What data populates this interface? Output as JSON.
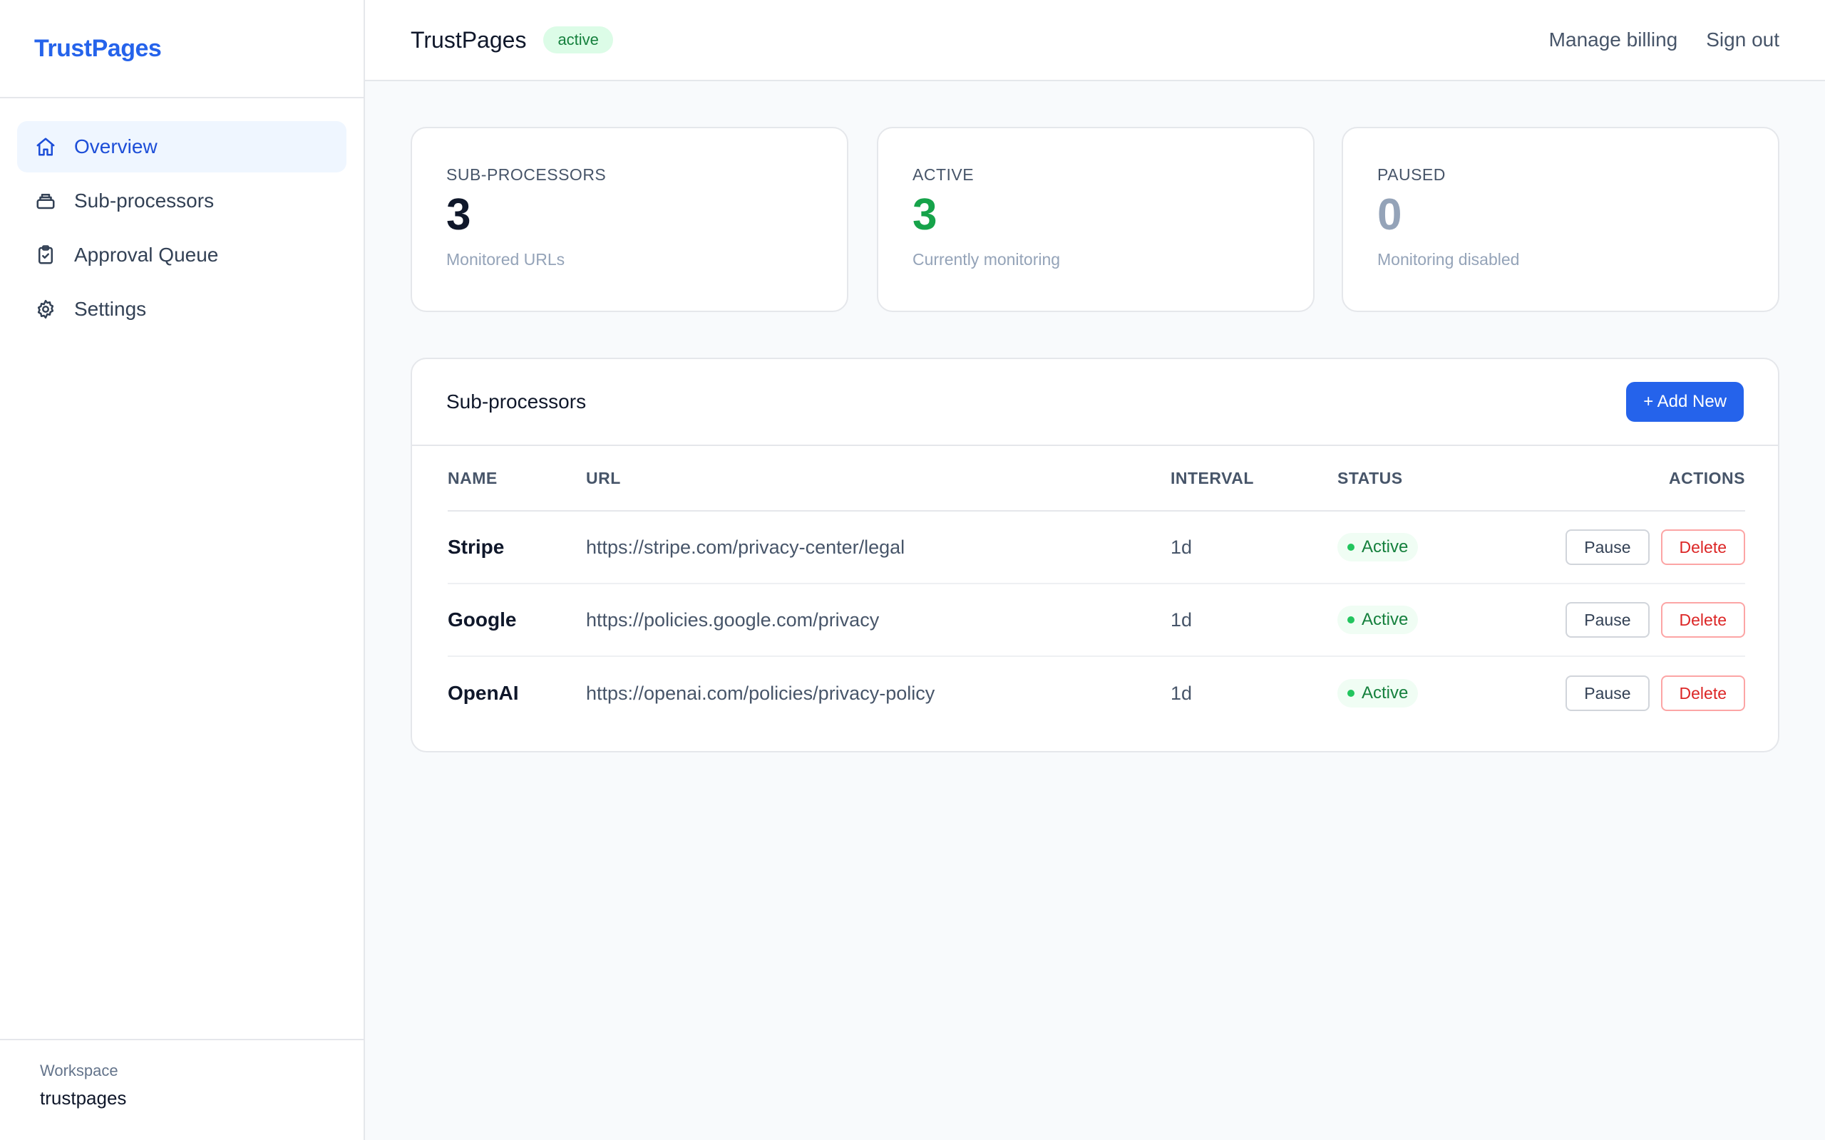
{
  "app": {
    "brand": "TrustPages"
  },
  "sidebar": {
    "items": [
      {
        "label": "Overview",
        "icon": "home-icon",
        "active": true
      },
      {
        "label": "Sub-processors",
        "icon": "database-icon",
        "active": false
      },
      {
        "label": "Approval Queue",
        "icon": "clipboard-check-icon",
        "active": false
      },
      {
        "label": "Settings",
        "icon": "gear-icon",
        "active": false
      }
    ],
    "workspace": {
      "label": "Workspace",
      "name": "trustpages"
    }
  },
  "header": {
    "title": "TrustPages",
    "badge": "active",
    "links": {
      "billing": "Manage billing",
      "signout": "Sign out"
    }
  },
  "stats": [
    {
      "label": "SUB-PROCESSORS",
      "value": "3",
      "sub": "Monitored URLs",
      "color": "#0f172a"
    },
    {
      "label": "ACTIVE",
      "value": "3",
      "sub": "Currently monitoring",
      "color": "#16a34a"
    },
    {
      "label": "PAUSED",
      "value": "0",
      "sub": "Monitoring disabled",
      "color": "#94a3b8"
    }
  ],
  "table": {
    "title": "Sub-processors",
    "add_label": "+ Add New",
    "columns": {
      "name": "NAME",
      "url": "URL",
      "interval": "INTERVAL",
      "status": "STATUS",
      "actions": "ACTIONS"
    },
    "rows": [
      {
        "name": "Stripe",
        "url": "https://stripe.com/privacy-center/legal",
        "interval": "1d",
        "status": "Active",
        "pause": "Pause",
        "delete": "Delete"
      },
      {
        "name": "Google",
        "url": "https://policies.google.com/privacy",
        "interval": "1d",
        "status": "Active",
        "pause": "Pause",
        "delete": "Delete"
      },
      {
        "name": "OpenAI",
        "url": "https://openai.com/policies/privacy-policy",
        "interval": "1d",
        "status": "Active",
        "pause": "Pause",
        "delete": "Delete"
      }
    ]
  },
  "colors": {
    "accent": "#2563eb",
    "success": "#16a34a",
    "danger": "#dc2626"
  }
}
